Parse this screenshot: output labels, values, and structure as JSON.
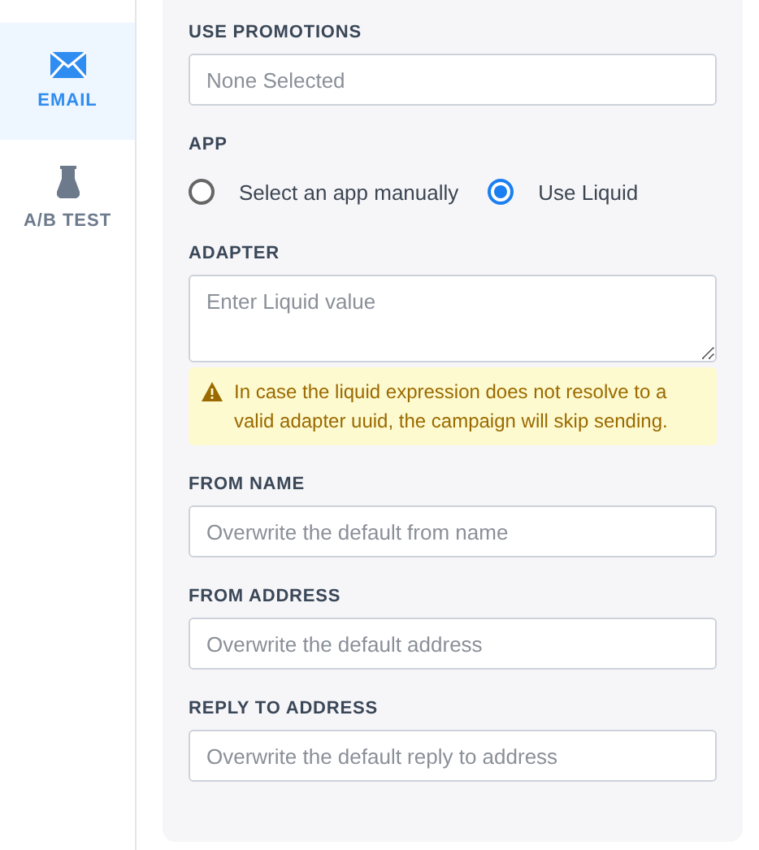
{
  "sidebar": {
    "items": [
      {
        "label": "EMAIL",
        "kind": "mail",
        "selected": true
      },
      {
        "label": "A/B TEST",
        "kind": "flask",
        "selected": false
      }
    ]
  },
  "form": [
    {
      "kind": "input",
      "label": "USE PROMOTIONS",
      "placeholder": "None Selected"
    },
    {
      "kind": "radio",
      "label": "APP",
      "options": [
        {
          "label": "Select an app manually",
          "selected": false
        },
        {
          "label": "Use Liquid",
          "selected": true
        }
      ]
    },
    {
      "kind": "textarea",
      "label": "ADAPTER",
      "placeholder": "Enter Liquid value",
      "warning": "In case the liquid expression does not resolve to a valid adapter uuid, the campaign will skip sending."
    },
    {
      "kind": "input",
      "label": "FROM NAME",
      "placeholder": "Overwrite the default from name"
    },
    {
      "kind": "input",
      "label": "FROM ADDRESS",
      "placeholder": "Overwrite the default address"
    },
    {
      "kind": "input",
      "label": "REPLY TO ADDRESS",
      "placeholder": "Overwrite the default reply to address"
    }
  ]
}
